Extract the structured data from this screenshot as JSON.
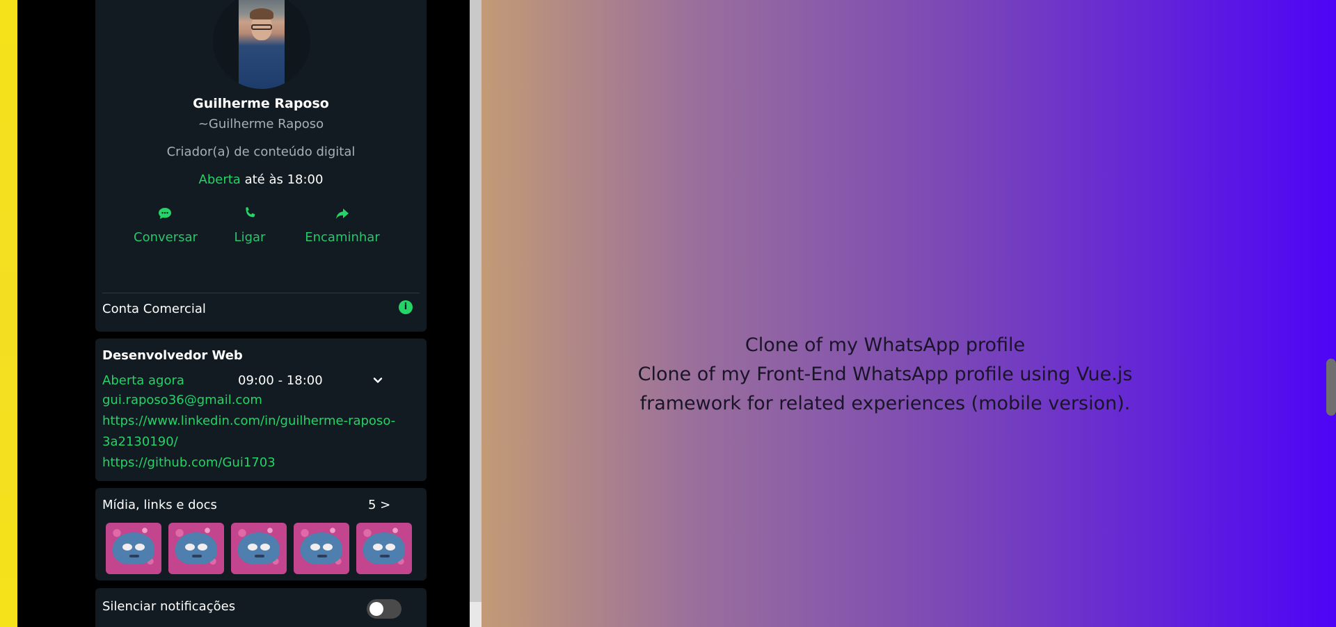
{
  "profile": {
    "name": "Guilherme Raposo",
    "handle": "~Guilherme Raposo",
    "role": "Criador(a) de conteúdo digital",
    "status_open": "Aberta",
    "status_until": "até às 18:00"
  },
  "actions": [
    {
      "label": "Conversar",
      "icon": "chat-icon"
    },
    {
      "label": "Ligar",
      "icon": "phone-icon"
    },
    {
      "label": "Encaminhar",
      "icon": "forward-icon"
    }
  ],
  "account": {
    "label": "Conta Comercial",
    "info_icon": "i"
  },
  "business": {
    "title": "Desenvolvedor Web",
    "open_now": "Aberta agora",
    "hours": "09:00 - 18:00",
    "email": "gui.raposo36@gmail.com",
    "linkedin_line1": "https://www.linkedin.com/in/guilherme-raposo-",
    "linkedin_line2": "3a2130190/",
    "github": "https://github.com/Gui1703"
  },
  "media": {
    "title": "Mídia, links e docs",
    "count": "5 >"
  },
  "settings": {
    "silence_label": "Silenciar notificações",
    "silence_enabled": false
  },
  "hero": {
    "line1": "Clone of my WhatsApp profile",
    "line2": "Clone of my Front-End WhatsApp profile using Vue.js",
    "line3": "framework for related experiences (mobile version)."
  },
  "colors": {
    "accent": "#25d366",
    "panel": "#111b21",
    "gradient_start": "#c29b76",
    "gradient_end": "#4d04f6"
  }
}
